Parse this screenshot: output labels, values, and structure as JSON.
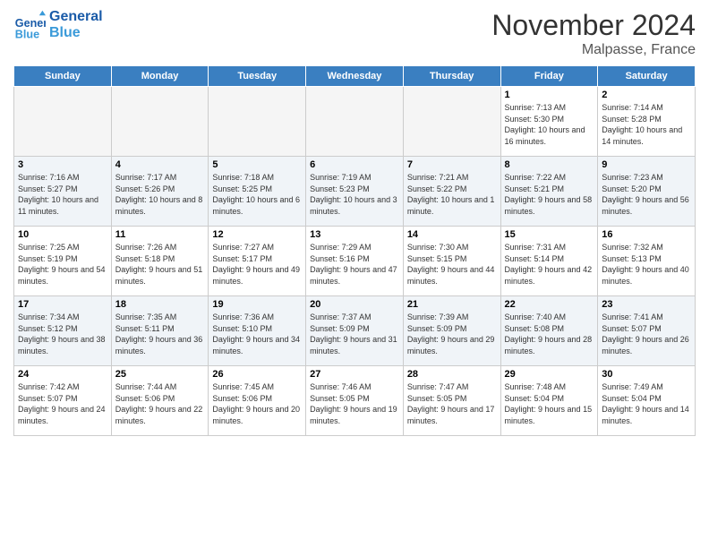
{
  "logo": {
    "text_general": "General",
    "text_blue": "Blue"
  },
  "title": "November 2024",
  "location": "Malpasse, France",
  "days_of_week": [
    "Sunday",
    "Monday",
    "Tuesday",
    "Wednesday",
    "Thursday",
    "Friday",
    "Saturday"
  ],
  "weeks": [
    [
      {
        "day": "",
        "info": ""
      },
      {
        "day": "",
        "info": ""
      },
      {
        "day": "",
        "info": ""
      },
      {
        "day": "",
        "info": ""
      },
      {
        "day": "",
        "info": ""
      },
      {
        "day": "1",
        "info": "Sunrise: 7:13 AM\nSunset: 5:30 PM\nDaylight: 10 hours and 16 minutes."
      },
      {
        "day": "2",
        "info": "Sunrise: 7:14 AM\nSunset: 5:28 PM\nDaylight: 10 hours and 14 minutes."
      }
    ],
    [
      {
        "day": "3",
        "info": "Sunrise: 7:16 AM\nSunset: 5:27 PM\nDaylight: 10 hours and 11 minutes."
      },
      {
        "day": "4",
        "info": "Sunrise: 7:17 AM\nSunset: 5:26 PM\nDaylight: 10 hours and 8 minutes."
      },
      {
        "day": "5",
        "info": "Sunrise: 7:18 AM\nSunset: 5:25 PM\nDaylight: 10 hours and 6 minutes."
      },
      {
        "day": "6",
        "info": "Sunrise: 7:19 AM\nSunset: 5:23 PM\nDaylight: 10 hours and 3 minutes."
      },
      {
        "day": "7",
        "info": "Sunrise: 7:21 AM\nSunset: 5:22 PM\nDaylight: 10 hours and 1 minute."
      },
      {
        "day": "8",
        "info": "Sunrise: 7:22 AM\nSunset: 5:21 PM\nDaylight: 9 hours and 58 minutes."
      },
      {
        "day": "9",
        "info": "Sunrise: 7:23 AM\nSunset: 5:20 PM\nDaylight: 9 hours and 56 minutes."
      }
    ],
    [
      {
        "day": "10",
        "info": "Sunrise: 7:25 AM\nSunset: 5:19 PM\nDaylight: 9 hours and 54 minutes."
      },
      {
        "day": "11",
        "info": "Sunrise: 7:26 AM\nSunset: 5:18 PM\nDaylight: 9 hours and 51 minutes."
      },
      {
        "day": "12",
        "info": "Sunrise: 7:27 AM\nSunset: 5:17 PM\nDaylight: 9 hours and 49 minutes."
      },
      {
        "day": "13",
        "info": "Sunrise: 7:29 AM\nSunset: 5:16 PM\nDaylight: 9 hours and 47 minutes."
      },
      {
        "day": "14",
        "info": "Sunrise: 7:30 AM\nSunset: 5:15 PM\nDaylight: 9 hours and 44 minutes."
      },
      {
        "day": "15",
        "info": "Sunrise: 7:31 AM\nSunset: 5:14 PM\nDaylight: 9 hours and 42 minutes."
      },
      {
        "day": "16",
        "info": "Sunrise: 7:32 AM\nSunset: 5:13 PM\nDaylight: 9 hours and 40 minutes."
      }
    ],
    [
      {
        "day": "17",
        "info": "Sunrise: 7:34 AM\nSunset: 5:12 PM\nDaylight: 9 hours and 38 minutes."
      },
      {
        "day": "18",
        "info": "Sunrise: 7:35 AM\nSunset: 5:11 PM\nDaylight: 9 hours and 36 minutes."
      },
      {
        "day": "19",
        "info": "Sunrise: 7:36 AM\nSunset: 5:10 PM\nDaylight: 9 hours and 34 minutes."
      },
      {
        "day": "20",
        "info": "Sunrise: 7:37 AM\nSunset: 5:09 PM\nDaylight: 9 hours and 31 minutes."
      },
      {
        "day": "21",
        "info": "Sunrise: 7:39 AM\nSunset: 5:09 PM\nDaylight: 9 hours and 29 minutes."
      },
      {
        "day": "22",
        "info": "Sunrise: 7:40 AM\nSunset: 5:08 PM\nDaylight: 9 hours and 28 minutes."
      },
      {
        "day": "23",
        "info": "Sunrise: 7:41 AM\nSunset: 5:07 PM\nDaylight: 9 hours and 26 minutes."
      }
    ],
    [
      {
        "day": "24",
        "info": "Sunrise: 7:42 AM\nSunset: 5:07 PM\nDaylight: 9 hours and 24 minutes."
      },
      {
        "day": "25",
        "info": "Sunrise: 7:44 AM\nSunset: 5:06 PM\nDaylight: 9 hours and 22 minutes."
      },
      {
        "day": "26",
        "info": "Sunrise: 7:45 AM\nSunset: 5:06 PM\nDaylight: 9 hours and 20 minutes."
      },
      {
        "day": "27",
        "info": "Sunrise: 7:46 AM\nSunset: 5:05 PM\nDaylight: 9 hours and 19 minutes."
      },
      {
        "day": "28",
        "info": "Sunrise: 7:47 AM\nSunset: 5:05 PM\nDaylight: 9 hours and 17 minutes."
      },
      {
        "day": "29",
        "info": "Sunrise: 7:48 AM\nSunset: 5:04 PM\nDaylight: 9 hours and 15 minutes."
      },
      {
        "day": "30",
        "info": "Sunrise: 7:49 AM\nSunset: 5:04 PM\nDaylight: 9 hours and 14 minutes."
      }
    ]
  ]
}
